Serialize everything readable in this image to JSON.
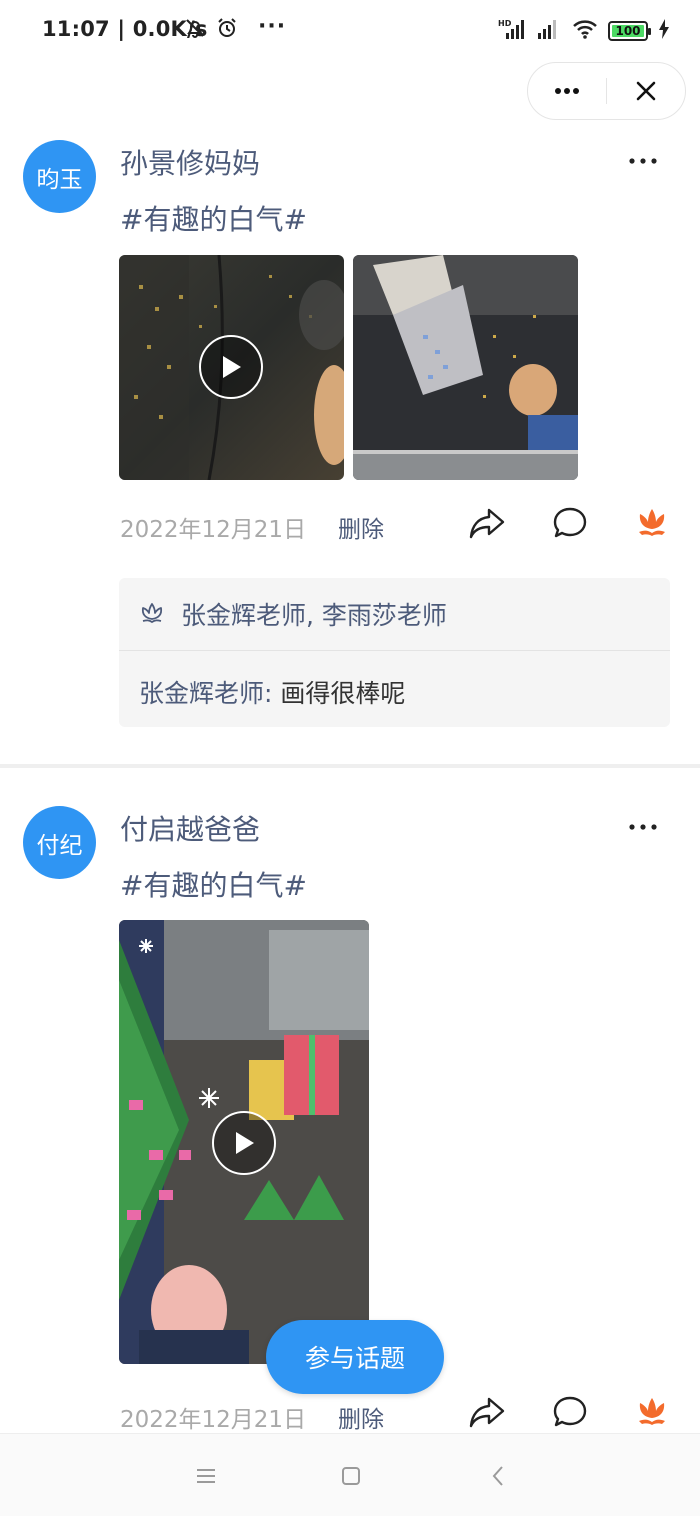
{
  "status_bar": {
    "time_speed": "11:07 | 0.0K/s",
    "battery_level": "100",
    "network_label": "HD"
  },
  "capsule": {
    "more_label": "···",
    "close_label": "✕"
  },
  "posts": [
    {
      "avatar_text": "昀玉",
      "author": "孙景修妈妈",
      "topic": "#有趣的白气#",
      "more": "···",
      "date": "2022年12月21日",
      "delete_label": "删除",
      "likes": "张金辉老师, 李雨莎老师",
      "comment_author": "张金辉老师:",
      "comment_text": "画得很棒呢"
    },
    {
      "avatar_text": "付纪",
      "author": "付启越爸爸",
      "topic": "#有趣的白气#",
      "more": "···",
      "date": "2022年12月21日",
      "delete_label": "删除"
    }
  ],
  "join_button": "参与话题",
  "colors": {
    "accent": "#2f95f3",
    "name": "#4d5b7a",
    "like": "#f36b2c"
  }
}
